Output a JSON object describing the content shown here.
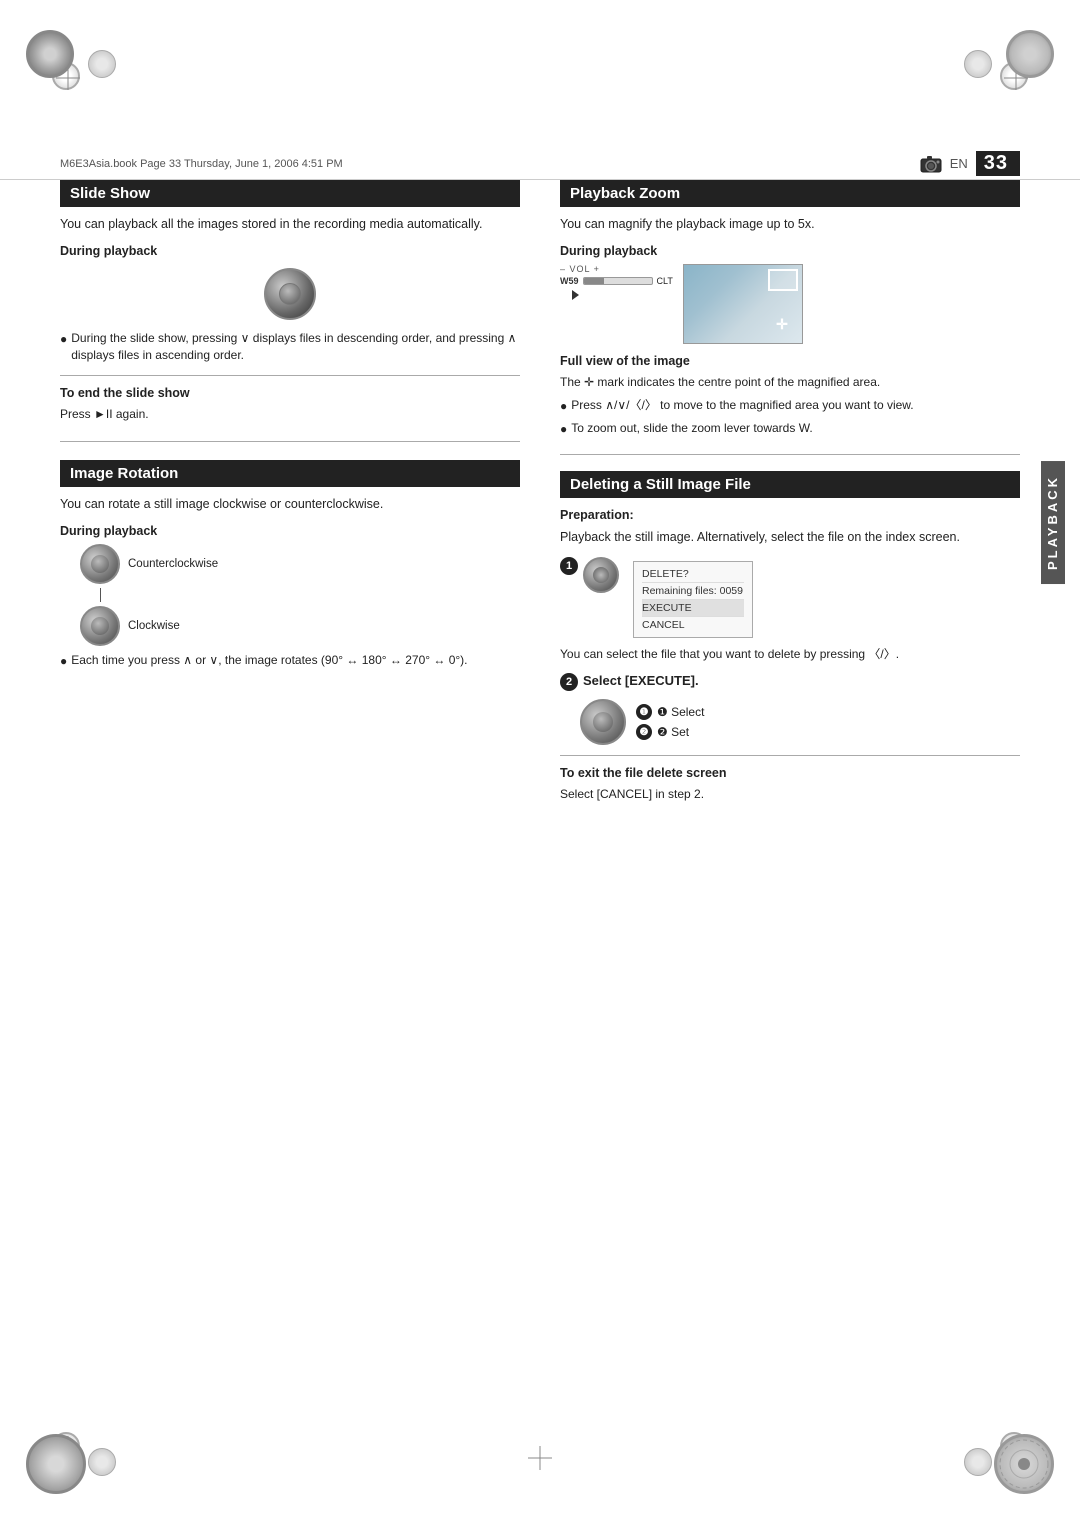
{
  "page": {
    "file_info": "M6E3Asia.book  Page 33  Thursday, June 1, 2006  4:51 PM",
    "page_number": "33",
    "lang_badge": "EN",
    "playback_sidebar_label": "PLAYBACK"
  },
  "slide_show": {
    "header": "Slide Show",
    "intro": "You can playback all the images stored in the recording media automatically.",
    "during_playback_label": "During playback",
    "bullet1": "During the slide show, pressing ∨ displays files in descending order, and pressing ∧ displays files in ascending order.",
    "to_end_label": "To end the slide show",
    "to_end_text": "Press ►II again."
  },
  "image_rotation": {
    "header": "Image Rotation",
    "intro": "You can rotate a still image clockwise or counterclockwise.",
    "during_playback_label": "During playback",
    "counterclockwise_label": "Counterclockwise",
    "clockwise_label": "Clockwise",
    "bullet1": "Each time you press ∧ or ∨, the image rotates (90° ↔ 180° ↔ 270° ↔ 0°)."
  },
  "playback_zoom": {
    "header": "Playback Zoom",
    "intro": "You can magnify the playback image up to 5x.",
    "during_playback_label": "During playback",
    "vol_label": "– VOL +",
    "w59_label": "W59",
    "clt_label": "CLT",
    "full_view_label": "Full view of the image",
    "full_view_desc": "The ✛ mark indicates the centre point of the magnified area.",
    "bullet1": "Press ∧/∨/〈/〉 to move to the magnified area you want to view.",
    "bullet2": "To zoom out, slide the zoom lever towards W."
  },
  "deleting": {
    "header": "Deleting a Still Image File",
    "preparation_label": "Preparation:",
    "preparation_text": "Playback the still image. Alternatively, select the file on the index screen.",
    "step1_text": "You can select the file that you want to delete by pressing 〈/〉.",
    "dialog": {
      "delete_label": "DELETE?",
      "remaining_label": "Remaining files:",
      "remaining_value": "0059",
      "execute_label": "EXECUTE",
      "cancel_label": "CANCEL"
    },
    "step2_label": "Select [EXECUTE].",
    "select_label": "❶ Select",
    "set_label": "❷ Set",
    "to_exit_label": "To exit the file delete screen",
    "to_exit_text": "Select [CANCEL] in step 2."
  }
}
